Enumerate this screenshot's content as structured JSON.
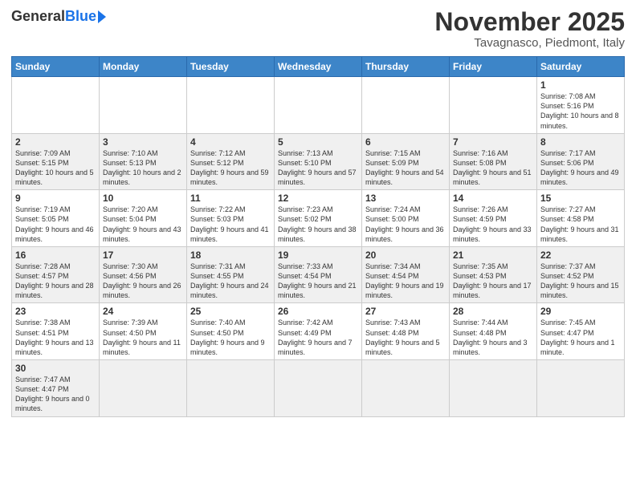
{
  "header": {
    "logo_general": "General",
    "logo_blue": "Blue",
    "title": "November 2025",
    "subtitle": "Tavagnasco, Piedmont, Italy"
  },
  "columns": [
    "Sunday",
    "Monday",
    "Tuesday",
    "Wednesday",
    "Thursday",
    "Friday",
    "Saturday"
  ],
  "weeks": [
    [
      {
        "day": "",
        "info": ""
      },
      {
        "day": "",
        "info": ""
      },
      {
        "day": "",
        "info": ""
      },
      {
        "day": "",
        "info": ""
      },
      {
        "day": "",
        "info": ""
      },
      {
        "day": "",
        "info": ""
      },
      {
        "day": "1",
        "info": "Sunrise: 7:08 AM\nSunset: 5:16 PM\nDaylight: 10 hours and 8 minutes."
      }
    ],
    [
      {
        "day": "2",
        "info": "Sunrise: 7:09 AM\nSunset: 5:15 PM\nDaylight: 10 hours and 5 minutes."
      },
      {
        "day": "3",
        "info": "Sunrise: 7:10 AM\nSunset: 5:13 PM\nDaylight: 10 hours and 2 minutes."
      },
      {
        "day": "4",
        "info": "Sunrise: 7:12 AM\nSunset: 5:12 PM\nDaylight: 9 hours and 59 minutes."
      },
      {
        "day": "5",
        "info": "Sunrise: 7:13 AM\nSunset: 5:10 PM\nDaylight: 9 hours and 57 minutes."
      },
      {
        "day": "6",
        "info": "Sunrise: 7:15 AM\nSunset: 5:09 PM\nDaylight: 9 hours and 54 minutes."
      },
      {
        "day": "7",
        "info": "Sunrise: 7:16 AM\nSunset: 5:08 PM\nDaylight: 9 hours and 51 minutes."
      },
      {
        "day": "8",
        "info": "Sunrise: 7:17 AM\nSunset: 5:06 PM\nDaylight: 9 hours and 49 minutes."
      }
    ],
    [
      {
        "day": "9",
        "info": "Sunrise: 7:19 AM\nSunset: 5:05 PM\nDaylight: 9 hours and 46 minutes."
      },
      {
        "day": "10",
        "info": "Sunrise: 7:20 AM\nSunset: 5:04 PM\nDaylight: 9 hours and 43 minutes."
      },
      {
        "day": "11",
        "info": "Sunrise: 7:22 AM\nSunset: 5:03 PM\nDaylight: 9 hours and 41 minutes."
      },
      {
        "day": "12",
        "info": "Sunrise: 7:23 AM\nSunset: 5:02 PM\nDaylight: 9 hours and 38 minutes."
      },
      {
        "day": "13",
        "info": "Sunrise: 7:24 AM\nSunset: 5:00 PM\nDaylight: 9 hours and 36 minutes."
      },
      {
        "day": "14",
        "info": "Sunrise: 7:26 AM\nSunset: 4:59 PM\nDaylight: 9 hours and 33 minutes."
      },
      {
        "day": "15",
        "info": "Sunrise: 7:27 AM\nSunset: 4:58 PM\nDaylight: 9 hours and 31 minutes."
      }
    ],
    [
      {
        "day": "16",
        "info": "Sunrise: 7:28 AM\nSunset: 4:57 PM\nDaylight: 9 hours and 28 minutes."
      },
      {
        "day": "17",
        "info": "Sunrise: 7:30 AM\nSunset: 4:56 PM\nDaylight: 9 hours and 26 minutes."
      },
      {
        "day": "18",
        "info": "Sunrise: 7:31 AM\nSunset: 4:55 PM\nDaylight: 9 hours and 24 minutes."
      },
      {
        "day": "19",
        "info": "Sunrise: 7:33 AM\nSunset: 4:54 PM\nDaylight: 9 hours and 21 minutes."
      },
      {
        "day": "20",
        "info": "Sunrise: 7:34 AM\nSunset: 4:54 PM\nDaylight: 9 hours and 19 minutes."
      },
      {
        "day": "21",
        "info": "Sunrise: 7:35 AM\nSunset: 4:53 PM\nDaylight: 9 hours and 17 minutes."
      },
      {
        "day": "22",
        "info": "Sunrise: 7:37 AM\nSunset: 4:52 PM\nDaylight: 9 hours and 15 minutes."
      }
    ],
    [
      {
        "day": "23",
        "info": "Sunrise: 7:38 AM\nSunset: 4:51 PM\nDaylight: 9 hours and 13 minutes."
      },
      {
        "day": "24",
        "info": "Sunrise: 7:39 AM\nSunset: 4:50 PM\nDaylight: 9 hours and 11 minutes."
      },
      {
        "day": "25",
        "info": "Sunrise: 7:40 AM\nSunset: 4:50 PM\nDaylight: 9 hours and 9 minutes."
      },
      {
        "day": "26",
        "info": "Sunrise: 7:42 AM\nSunset: 4:49 PM\nDaylight: 9 hours and 7 minutes."
      },
      {
        "day": "27",
        "info": "Sunrise: 7:43 AM\nSunset: 4:48 PM\nDaylight: 9 hours and 5 minutes."
      },
      {
        "day": "28",
        "info": "Sunrise: 7:44 AM\nSunset: 4:48 PM\nDaylight: 9 hours and 3 minutes."
      },
      {
        "day": "29",
        "info": "Sunrise: 7:45 AM\nSunset: 4:47 PM\nDaylight: 9 hours and 1 minute."
      }
    ],
    [
      {
        "day": "30",
        "info": "Sunrise: 7:47 AM\nSunset: 4:47 PM\nDaylight: 9 hours and 0 minutes."
      },
      {
        "day": "",
        "info": ""
      },
      {
        "day": "",
        "info": ""
      },
      {
        "day": "",
        "info": ""
      },
      {
        "day": "",
        "info": ""
      },
      {
        "day": "",
        "info": ""
      },
      {
        "day": "",
        "info": ""
      }
    ]
  ]
}
